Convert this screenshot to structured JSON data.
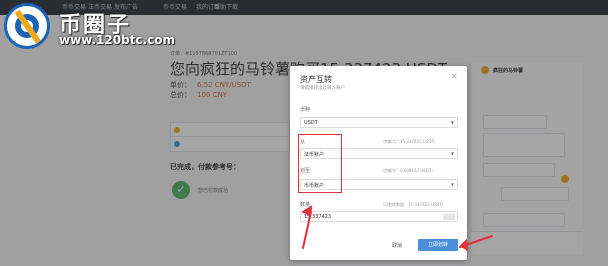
{
  "nav": {
    "items": [
      "币币交易",
      "法币交易",
      "发布广告",
      "币币交易",
      "我的订单"
    ],
    "right": "帮助下载"
  },
  "watermark": {
    "cn": "币圈子",
    "url": "www.120btc.com"
  },
  "order": {
    "number": "订单：#1157868701ZT100",
    "title": "您向疯狂的马铃薯购买15.337423 USDT",
    "unit_price_label": "单价：",
    "unit_price_value": "6.52 CNY/USDT",
    "total_label": "总价：",
    "total_value": "100 CNY",
    "pay_label": "已完成，付款参考号：",
    "notice": "您已付款成功"
  },
  "modal": {
    "title": "资产互转",
    "subtitle": "请选择转出及转入账户",
    "coin_label": "币种",
    "coin_value": "USDT",
    "from_label": "从",
    "from_hint": "（余额为：15.337423 USDT）",
    "from_value": "法币账户",
    "to_label": "划至",
    "to_hint": "（余额为：0.009167 USDT）",
    "to_value": "币币账户",
    "amount_label": "数量",
    "amount_hint": "（可划转数量：15.337423 USDT）",
    "amount_value": "15.337423",
    "cancel_label": "取消",
    "confirm_label": "立即划转"
  },
  "chat": {
    "name": "疯狂的马铃薯"
  },
  "colors": {
    "annotation_red": "#e0303a",
    "confirm_blue": "#4c8ed9",
    "success_green": "#52b36a",
    "brand_blue": "#1c63b8"
  }
}
